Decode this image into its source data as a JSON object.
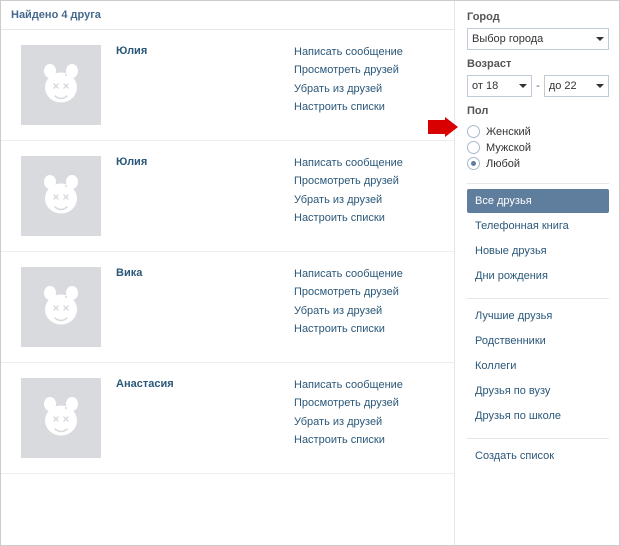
{
  "header": {
    "title": "Найдено 4 друга"
  },
  "friends": [
    {
      "name": "Юлия",
      "actions": [
        "Написать сообщение",
        "Просмотреть друзей",
        "Убрать из друзей",
        "Настроить списки"
      ]
    },
    {
      "name": "Юлия",
      "actions": [
        "Написать сообщение",
        "Просмотреть друзей",
        "Убрать из друзей",
        "Настроить списки"
      ]
    },
    {
      "name": "Вика",
      "actions": [
        "Написать сообщение",
        "Просмотреть друзей",
        "Убрать из друзей",
        "Настроить списки"
      ]
    },
    {
      "name": "Анастасия",
      "actions": [
        "Написать сообщение",
        "Просмотреть друзей",
        "Убрать из друзей",
        "Настроить списки"
      ]
    }
  ],
  "sidebar": {
    "city_label": "Город",
    "city_placeholder": "Выбор города",
    "age_label": "Возраст",
    "age_from": "от 18",
    "age_to": "до 22",
    "dash": "-",
    "gender_label": "Пол",
    "gender_options": [
      {
        "label": "Женский",
        "checked": false
      },
      {
        "label": "Мужской",
        "checked": false
      },
      {
        "label": "Любой",
        "checked": true
      }
    ],
    "groups": [
      {
        "items": [
          "Все друзья",
          "Телефонная книга",
          "Новые друзья",
          "Дни рождения"
        ],
        "active": 0
      },
      {
        "items": [
          "Лучшие друзья",
          "Родственники",
          "Коллеги",
          "Друзья по вузу",
          "Друзья по школе"
        ],
        "active": -1
      },
      {
        "items": [
          "Создать список"
        ],
        "active": -1
      }
    ]
  }
}
